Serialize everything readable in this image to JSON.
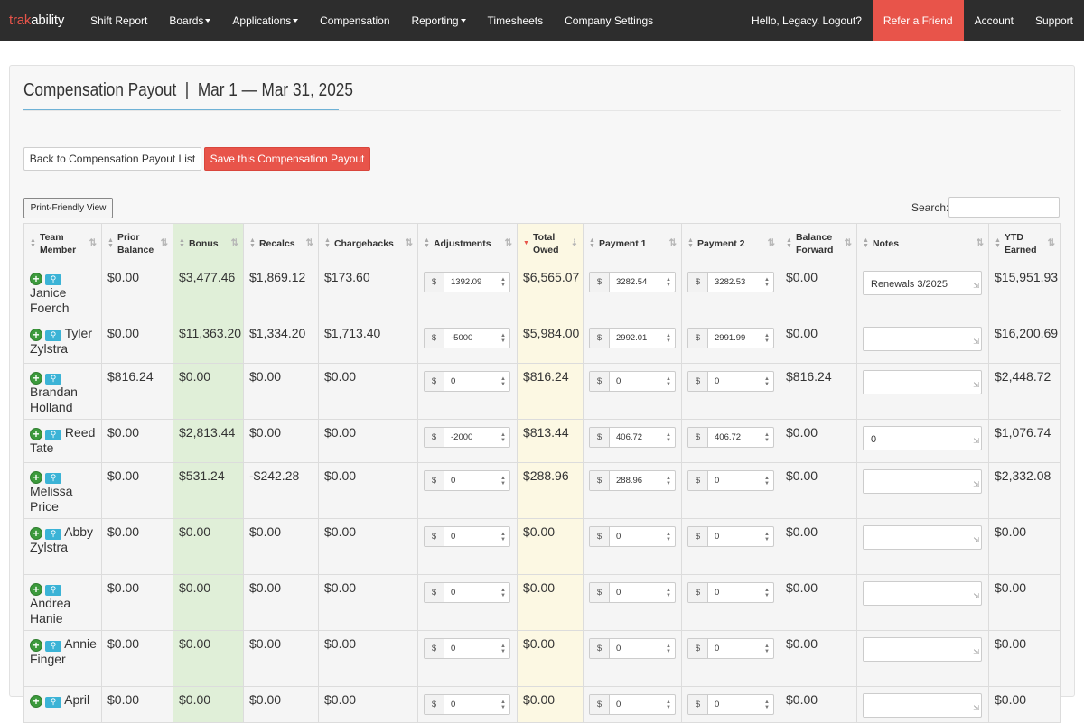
{
  "nav": {
    "brand_part1": "trak",
    "brand_part2": "ability",
    "items": [
      {
        "label": "Shift Report"
      },
      {
        "label": "Boards"
      },
      {
        "label": "Applications"
      },
      {
        "label": "Compensation"
      },
      {
        "label": "Reporting"
      },
      {
        "label": "Timesheets"
      },
      {
        "label": "Company Settings"
      }
    ],
    "greeting": "Hello, Legacy. Logout?",
    "refer": "Refer a Friend",
    "account": "Account",
    "support": "Support",
    "refer_color": "#e8544a"
  },
  "page": {
    "title": "Compensation Payout  |  Mar 1 — Mar 31, 2025",
    "back_button": "Back to Compensation Payout List",
    "save_button": "Save this Compensation Payout",
    "print_button": "Print-Friendly View",
    "search_label": "Search:"
  },
  "table": {
    "headers": {
      "team_member": [
        "Team",
        "Member"
      ],
      "prior_balance": [
        "Prior",
        "Balance"
      ],
      "bonus": "Bonus",
      "recalcs": "Recalcs",
      "chargebacks": "Chargebacks",
      "adjustments": "Adjustments",
      "total_owed": [
        "Total",
        "Owed"
      ],
      "payment1": "Payment 1",
      "payment2": "Payment 2",
      "balance_forward": [
        "Balance",
        "Forward"
      ],
      "notes": "Notes",
      "ytd_earned": [
        "YTD",
        "Earned"
      ]
    },
    "currency_prefix": "$",
    "rows": [
      {
        "first": "Janice",
        "last": "Foerch",
        "prior": "$0.00",
        "bonus": "$3,477.46",
        "recalcs": "$1,869.12",
        "chargebacks": "$173.60",
        "adj": "1392.09",
        "owed": "$6,565.07",
        "p1": "3282.54",
        "p2": "3282.53",
        "bf": "$0.00",
        "notes": "Renewals 3/2025",
        "ytd": "$15,951.93"
      },
      {
        "first": "Tyler",
        "last": "Zylstra",
        "prior": "$0.00",
        "bonus": "$11,363.20",
        "recalcs": "$1,334.20",
        "chargebacks": "$1,713.40",
        "adj": "-5000",
        "owed": "$5,984.00",
        "p1": "2992.01",
        "p2": "2991.99",
        "bf": "$0.00",
        "notes": "",
        "ytd": "$16,200.69"
      },
      {
        "first": "Brandan",
        "last": "Holland",
        "prior": "$816.24",
        "bonus": "$0.00",
        "recalcs": "$0.00",
        "chargebacks": "$0.00",
        "adj": "0",
        "owed": "$816.24",
        "p1": "0",
        "p2": "0",
        "bf": "$816.24",
        "notes": "",
        "ytd": "$2,448.72"
      },
      {
        "first": "Reed",
        "last": "Tate",
        "prior": "$0.00",
        "bonus": "$2,813.44",
        "recalcs": "$0.00",
        "chargebacks": "$0.00",
        "adj": "-2000",
        "owed": "$813.44",
        "p1": "406.72",
        "p2": "406.72",
        "bf": "$0.00",
        "notes": "0",
        "ytd": "$1,076.74"
      },
      {
        "first": "Melissa",
        "last": "Price",
        "prior": "$0.00",
        "bonus": "$531.24",
        "recalcs": "-$242.28",
        "chargebacks": "$0.00",
        "adj": "0",
        "owed": "$288.96",
        "p1": "288.96",
        "p2": "0",
        "bf": "$0.00",
        "notes": "",
        "ytd": "$2,332.08"
      },
      {
        "first": "Abby",
        "last": "Zylstra",
        "prior": "$0.00",
        "bonus": "$0.00",
        "recalcs": "$0.00",
        "chargebacks": "$0.00",
        "adj": "0",
        "owed": "$0.00",
        "p1": "0",
        "p2": "0",
        "bf": "$0.00",
        "notes": "",
        "ytd": "$0.00"
      },
      {
        "first": "Andrea",
        "last": "Hanie",
        "prior": "$0.00",
        "bonus": "$0.00",
        "recalcs": "$0.00",
        "chargebacks": "$0.00",
        "adj": "0",
        "owed": "$0.00",
        "p1": "0",
        "p2": "0",
        "bf": "$0.00",
        "notes": "",
        "ytd": "$0.00"
      },
      {
        "first": "Annie",
        "last": "Finger",
        "prior": "$0.00",
        "bonus": "$0.00",
        "recalcs": "$0.00",
        "chargebacks": "$0.00",
        "adj": "0",
        "owed": "$0.00",
        "p1": "0",
        "p2": "0",
        "bf": "$0.00",
        "notes": "",
        "ytd": "$0.00"
      },
      {
        "first": "April",
        "last": "",
        "prior": "$0.00",
        "bonus": "$0.00",
        "recalcs": "$0.00",
        "chargebacks": "$0.00",
        "adj": "0",
        "owed": "$0.00",
        "p1": "0",
        "p2": "0",
        "bf": "$0.00",
        "notes": "",
        "ytd": "$0.00"
      }
    ]
  },
  "colors": {
    "bonus_column": "#e0efd8",
    "total_owed_column": "#fcf8e3",
    "save_button": "#e8544a",
    "add_icon": "#3c9a3c",
    "view_icon": "#3bb3d6"
  }
}
